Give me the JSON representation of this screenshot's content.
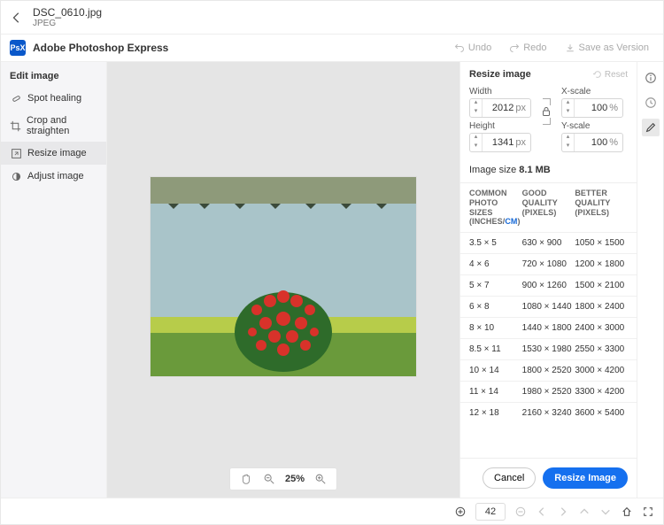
{
  "titlebar": {
    "filename": "DSC_0610.jpg",
    "filetype": "JPEG"
  },
  "subbar": {
    "logo": "PsX",
    "brand": "Adobe Photoshop Express",
    "undo": "Undo",
    "redo": "Redo",
    "save": "Save as Version"
  },
  "left": {
    "heading": "Edit image",
    "items": [
      {
        "label": "Spot healing"
      },
      {
        "label": "Crop and straighten"
      },
      {
        "label": "Resize image"
      },
      {
        "label": "Adjust image"
      }
    ]
  },
  "zoom": {
    "hand": "✋",
    "value": "25%"
  },
  "right": {
    "heading": "Resize image",
    "reset": "Reset",
    "width_label": "Width",
    "height_label": "Height",
    "xscale_label": "X-scale",
    "yscale_label": "Y-scale",
    "width_value": "2012",
    "height_value": "1341",
    "xscale_value": "100",
    "yscale_value": "100",
    "px": "px",
    "pct": "%",
    "image_size_label": "Image size",
    "image_size_value": "8.1 MB"
  },
  "table": {
    "head": {
      "col1a": "COMMON",
      "col1b": "PHOTO SIZES",
      "col1c_pre": "(INCHES/",
      "col1c_link": "CM",
      "col1c_post": ")",
      "col2a": "GOOD",
      "col2b": "QUALITY",
      "col2c": "(PIXELS)",
      "col3a": "BETTER",
      "col3b": "QUALITY",
      "col3c": "(PIXELS)"
    },
    "rows": [
      {
        "size": "3.5 × 5",
        "good": "630 × 900",
        "better": "1050 × 1500"
      },
      {
        "size": "4 × 6",
        "good": "720 × 1080",
        "better": "1200 × 1800"
      },
      {
        "size": "5 × 7",
        "good": "900 × 1260",
        "better": "1500 × 2100"
      },
      {
        "size": "6 × 8",
        "good": "1080 × 1440",
        "better": "1800 × 2400"
      },
      {
        "size": "8 × 10",
        "good": "1440 × 1800",
        "better": "2400 × 3000"
      },
      {
        "size": "8.5 × 11",
        "good": "1530 × 1980",
        "better": "2550 × 3300"
      },
      {
        "size": "10 × 14",
        "good": "1800 × 2520",
        "better": "3000 × 4200"
      },
      {
        "size": "11 × 14",
        "good": "1980 × 2520",
        "better": "3300 × 4200"
      },
      {
        "size": "12 × 18",
        "good": "2160 × 3240",
        "better": "3600 × 5400"
      }
    ]
  },
  "actions": {
    "cancel": "Cancel",
    "resize": "Resize Image"
  },
  "bottombar": {
    "page_value": "42"
  }
}
